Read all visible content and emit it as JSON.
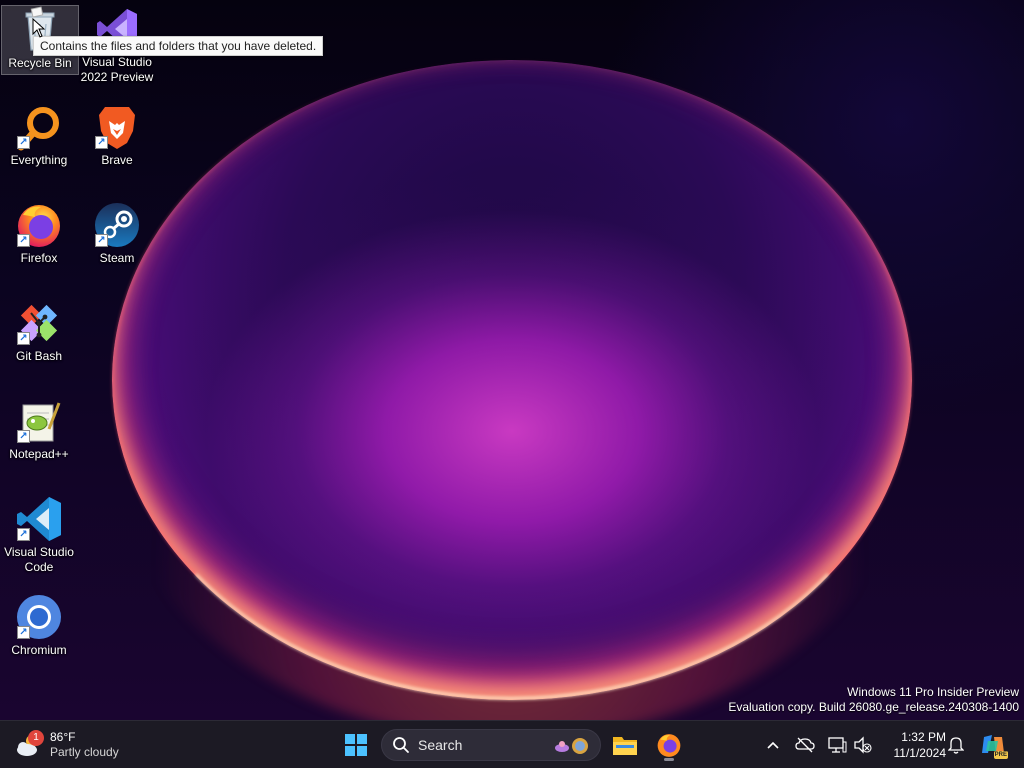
{
  "desktop": {
    "icons": [
      {
        "label": "Recycle Bin"
      },
      {
        "label": "Visual Studio 2022 Preview"
      },
      {
        "label": "Everything"
      },
      {
        "label": "Brave"
      },
      {
        "label": "Firefox"
      },
      {
        "label": "Steam"
      },
      {
        "label": "Git Bash"
      },
      {
        "label": "Notepad++"
      },
      {
        "label": "Visual Studio Code"
      },
      {
        "label": "Chromium"
      }
    ],
    "tooltip": "Contains the files and folders that you have deleted.",
    "watermark": {
      "line1": "Windows 11 Pro Insider Preview",
      "line2": "Evaluation copy. Build 26080.ge_release.240308-1400"
    }
  },
  "taskbar": {
    "weather": {
      "temp": "86°F",
      "condition": "Partly cloudy",
      "badge": "1"
    },
    "search_placeholder": "Search",
    "clock": {
      "time": "1:32 PM",
      "date": "11/1/2024"
    },
    "copilot_badge": "PRE",
    "icons": [
      "start-icon",
      "search-icon",
      "file-explorer-icon",
      "firefox-icon",
      "chevron-up-icon",
      "onedrive-offline-icon",
      "display-icon",
      "speaker-muted-icon",
      "bell-icon",
      "copilot-icon"
    ]
  },
  "colors": {
    "taskbar_bg": "#1c1a24",
    "accent": "#1a6ed8"
  }
}
